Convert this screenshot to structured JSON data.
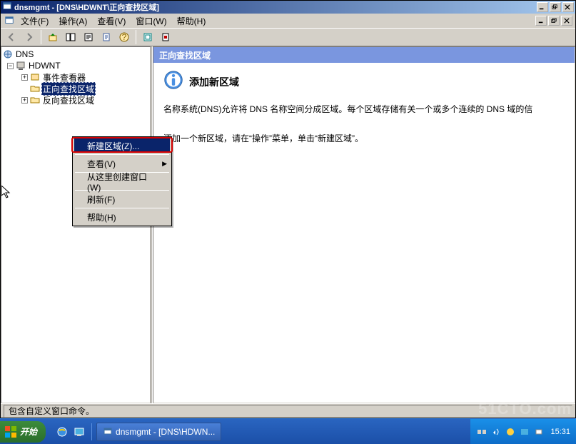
{
  "window": {
    "title": "dnsmgmt - [DNS\\HDWNT\\正向查找区域]"
  },
  "menus": {
    "file": "文件(F)",
    "action": "操作(A)",
    "view": "查看(V)",
    "window": "窗口(W)",
    "help": "帮助(H)"
  },
  "tree": {
    "root": "DNS",
    "server": "HDWNT",
    "event_viewer": "事件查看器",
    "fwd_zone": "正向查找区域",
    "rev_zone": "反向查找区域"
  },
  "context_menu": {
    "new_zone": "新建区域(Z)...",
    "view": "查看(V)",
    "new_window": "从这里创建窗口(W)",
    "refresh": "刷新(F)",
    "help": "帮助(H)"
  },
  "detail": {
    "header": "正向查找区域",
    "heading": "添加新区域",
    "line1": "名称系统(DNS)允许将 DNS 名称空间分成区域。每个区域存储有关一个或多个连续的 DNS 域的信",
    "line2": "添加一个新区域，请在“操作”菜单，单击“新建区域”。"
  },
  "statusbar": {
    "text": "包含自定义窗口命令。"
  },
  "taskbar": {
    "start": "开始",
    "task": "dnsmgmt - [DNS\\HDWN...",
    "clock": "15:31"
  },
  "watermark": "51CTO.com"
}
